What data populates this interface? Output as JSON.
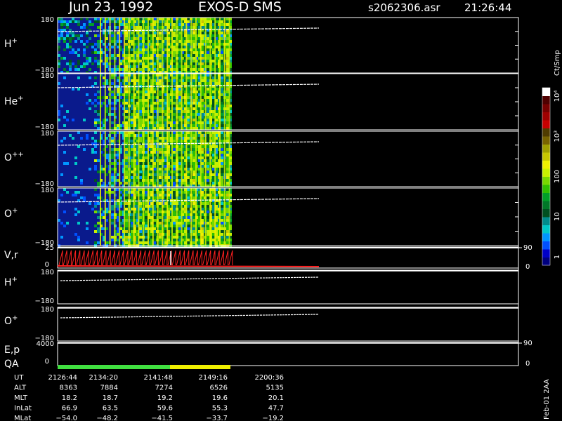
{
  "chart_data": {
    "type": "heatmap",
    "title_left": "Jun 23, 1992",
    "title_mid": "EXOS-D SMS",
    "title_file": "s2062306.asr",
    "title_time": "21:26:44",
    "colorbar": {
      "unit": "Ct/Smp",
      "tick_labels": [
        "1",
        "10",
        "100",
        "10³",
        "10⁴"
      ],
      "colors": [
        "#000080",
        "#0000c8",
        "#0050ff",
        "#0096ff",
        "#00c8c8",
        "#008c8c",
        "#005020",
        "#007828",
        "#00a028",
        "#30c000",
        "#78d800",
        "#c8f000",
        "#f0f000",
        "#c8c800",
        "#a0a000",
        "#786400",
        "#503c00",
        "#c80000",
        "#a00000",
        "#780000",
        "#500000",
        "#ffffff"
      ]
    },
    "panels": [
      {
        "label": "H",
        "sup": "+",
        "ymax": "180",
        "ymin": "−180",
        "bg": "low_patchy"
      },
      {
        "label": "He",
        "sup": "+",
        "ymax": "180",
        "ymin": "−180",
        "bg": "low"
      },
      {
        "label": "O",
        "sup": "++",
        "ymax": "180",
        "ymin": "−180",
        "bg": "low"
      },
      {
        "label": "O",
        "sup": "+",
        "ymax": "180",
        "ymin": "−180",
        "bg": "low"
      }
    ],
    "vr_panel": {
      "label": "V,r",
      "left_max": "25",
      "left_min": "0",
      "right_max": "90",
      "right_min": "0"
    },
    "line_panels": [
      {
        "label": "H",
        "sup": "+",
        "ymax": "180",
        "ymin": "−180"
      },
      {
        "label": "O",
        "sup": "+",
        "ymax": "180",
        "ymin": "−180"
      }
    ],
    "ep_panel": {
      "label": "E,p",
      "left_max": "4000",
      "left_min": "0",
      "right_max": "90",
      "right_min": "0"
    },
    "qa_label": "QA",
    "time_table": {
      "rows": [
        {
          "name": "UT",
          "values": [
            "2126:44",
            "2134:20",
            "2141:48",
            "2149:16",
            "2200:36"
          ]
        },
        {
          "name": "ALT",
          "values": [
            "8363",
            "7884",
            "7274",
            "6526",
            "5135"
          ]
        },
        {
          "name": "MLT",
          "values": [
            "18.2",
            "18.7",
            "19.2",
            "19.6",
            "20.1"
          ]
        },
        {
          "name": "InLat",
          "values": [
            "66.9",
            "63.5",
            "59.6",
            "55.3",
            "47.7"
          ]
        },
        {
          "name": "MLat",
          "values": [
            "−54.0",
            "−48.2",
            "−41.5",
            "−33.7",
            "−19.2"
          ]
        }
      ]
    },
    "footer_text": "Feb-01 2AA"
  }
}
